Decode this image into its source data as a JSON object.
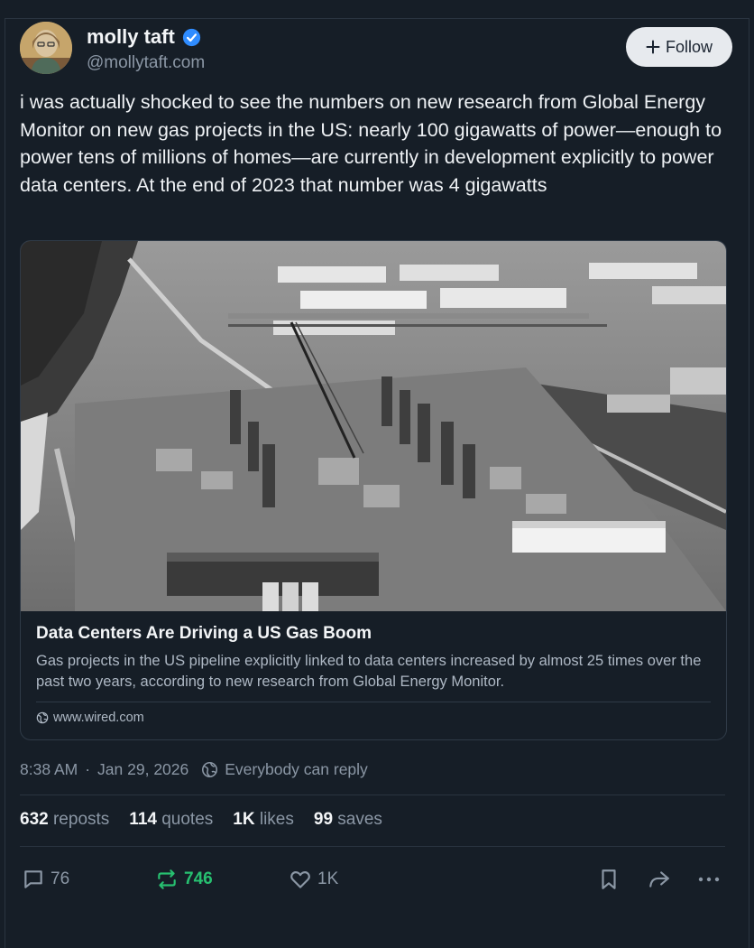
{
  "author": {
    "name": "molly taft",
    "handle": "@mollytaft.com",
    "verified": true,
    "follow_label": "Follow"
  },
  "post": {
    "text": "i was actually shocked to see the numbers on new research from Global Energy Monitor on new gas projects in the US: nearly 100 gigawatts of power—enough to power tens of millions of homes—are currently in development explicitly to power data centers. At the end of 2023 that number was 4 gigawatts"
  },
  "link_card": {
    "title": "Data Centers Are Driving a US Gas Boom",
    "description": "Gas projects in the US pipeline explicitly linked to data centers increased by almost 25 times over the past two years, according to new research from Global Energy Monitor.",
    "domain": "www.wired.com"
  },
  "meta": {
    "time": "8:38 AM",
    "date": "Jan 29, 2026",
    "separator": "·",
    "reply_setting": "Everybody can reply"
  },
  "stats": {
    "reposts_count": "632",
    "reposts_label": "reposts",
    "quotes_count": "114",
    "quotes_label": "quotes",
    "likes_count": "1K",
    "likes_label": "likes",
    "saves_count": "99",
    "saves_label": "saves"
  },
  "actions": {
    "replies": "76",
    "reposts": "746",
    "likes": "1K"
  },
  "colors": {
    "background": "#161e27",
    "accent_verified": "#2f8cff",
    "repost_active": "#27c070",
    "muted_text": "#8b97a5"
  },
  "icons": [
    "verified-check-icon",
    "plus-icon",
    "globe-icon",
    "reply-setting-icon",
    "comment-icon",
    "repost-icon",
    "heart-icon",
    "bookmark-icon",
    "share-icon",
    "more-icon"
  ]
}
